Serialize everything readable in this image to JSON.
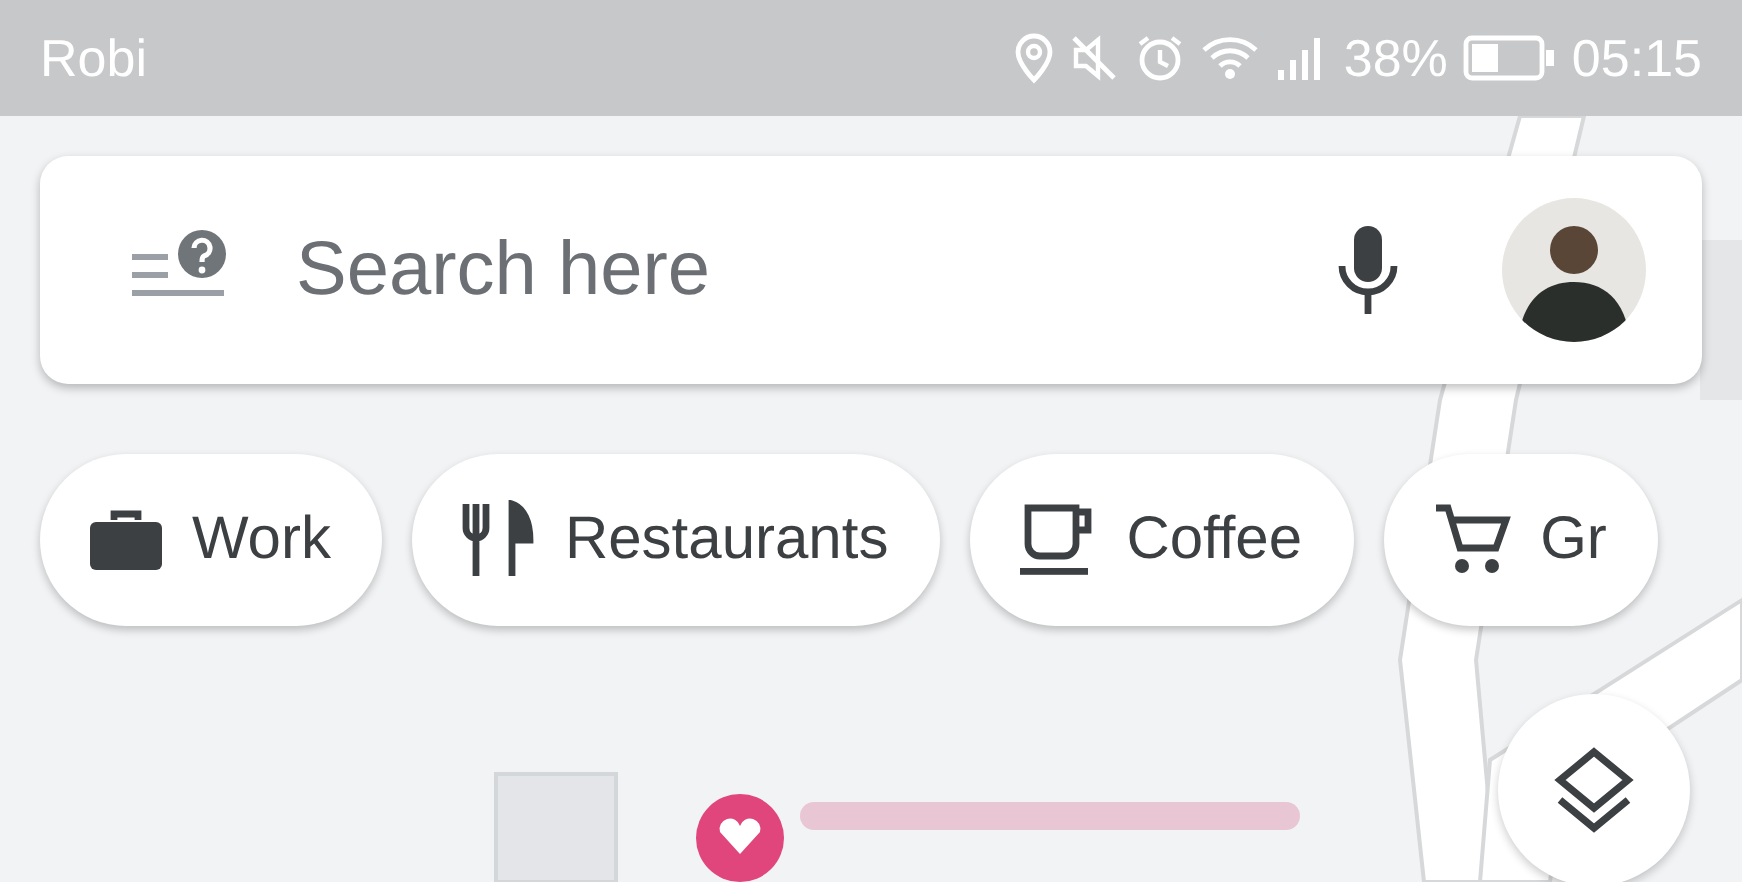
{
  "status_bar": {
    "carrier": "Robi",
    "battery": "38%",
    "time": "05:15"
  },
  "search": {
    "placeholder": "Search here"
  },
  "chips": [
    {
      "kind": "work",
      "label": "Work"
    },
    {
      "kind": "restaurants",
      "label": "Restaurants"
    },
    {
      "kind": "coffee",
      "label": "Coffee"
    },
    {
      "kind": "groceries",
      "label": "Gr"
    }
  ]
}
